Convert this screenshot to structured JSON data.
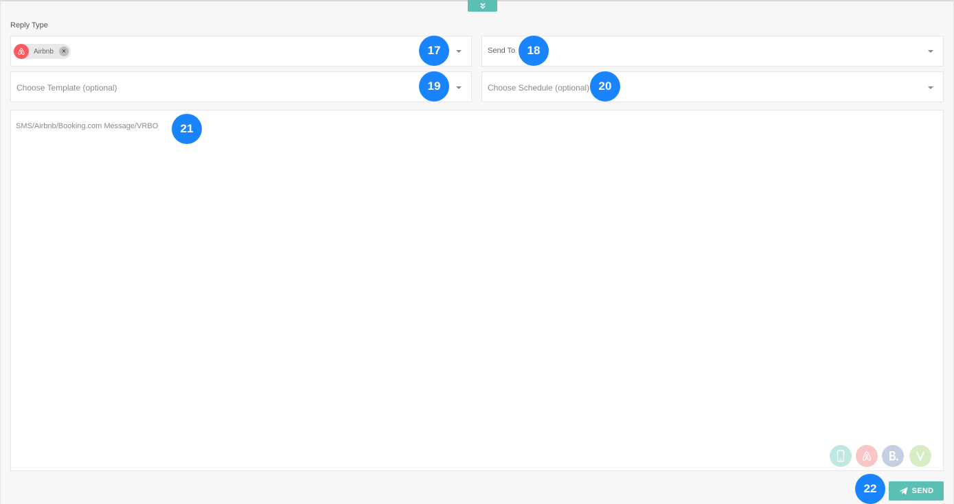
{
  "reply_type": {
    "label": "Reply Type",
    "selected_chip": {
      "label": "Airbnb",
      "icon": "airbnb-icon",
      "color": "#ff5a5f"
    },
    "badge": "17"
  },
  "send_to": {
    "label": "Send To",
    "badge": "18"
  },
  "template": {
    "placeholder": "Choose Template (optional)",
    "badge": "19"
  },
  "schedule": {
    "placeholder": "Choose Schedule (optional)",
    "badge": "20"
  },
  "message": {
    "placeholder": "SMS/Airbnb/Booking.com Message/VRBO",
    "badge": "21",
    "channels": [
      {
        "name": "sms",
        "icon": "phone-icon",
        "color": "#bfe8e1"
      },
      {
        "name": "airbnb",
        "icon": "airbnb-icon",
        "color": "#f9c5c7"
      },
      {
        "name": "booking",
        "icon": "booking-icon",
        "color": "#c5cfe0"
      },
      {
        "name": "vrbo",
        "icon": "vrbo-icon",
        "color": "#d8ecc6"
      }
    ]
  },
  "send": {
    "label": "SEND",
    "icon": "paper-plane-icon",
    "badge": "22"
  },
  "colors": {
    "accent": "#5bbfb3",
    "badge": "#1a84ff",
    "airbnb": "#ff5a5f"
  }
}
